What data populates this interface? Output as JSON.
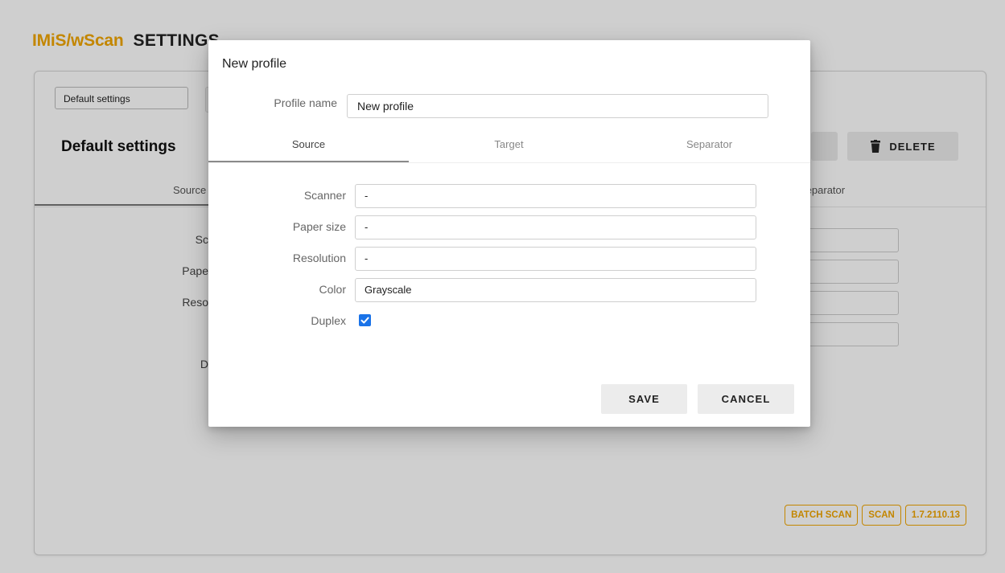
{
  "app": {
    "brand": "IMiS/wScan",
    "title": "SETTINGS",
    "status_color": "#3cb043",
    "accent_color": "#f0a500"
  },
  "background": {
    "profile_select_value": "Default settings",
    "heading": "Default settings",
    "delete_label": "DELETE",
    "tabs": [
      {
        "label": "Source"
      },
      {
        "label": "Separator"
      }
    ],
    "labels": [
      "Sc",
      "Pape",
      "Reso",
      "D"
    ],
    "footer": {
      "batch_scan": "BATCH SCAN",
      "scan": "SCAN",
      "version": "1.7.2110.13"
    }
  },
  "dialog": {
    "title": "New profile",
    "profile_name_label": "Profile name",
    "profile_name_value": "New profile",
    "tabs": [
      {
        "label": "Source",
        "active": true
      },
      {
        "label": "Target",
        "active": false
      },
      {
        "label": "Separator",
        "active": false
      }
    ],
    "fields": {
      "scanner": {
        "label": "Scanner",
        "value": "-"
      },
      "paper_size": {
        "label": "Paper size",
        "value": "-"
      },
      "resolution": {
        "label": "Resolution",
        "value": "-"
      },
      "color": {
        "label": "Color",
        "value": "Grayscale"
      },
      "duplex": {
        "label": "Duplex",
        "checked": true
      }
    },
    "save_label": "SAVE",
    "cancel_label": "CANCEL",
    "checkbox_color": "#1a73e8"
  }
}
